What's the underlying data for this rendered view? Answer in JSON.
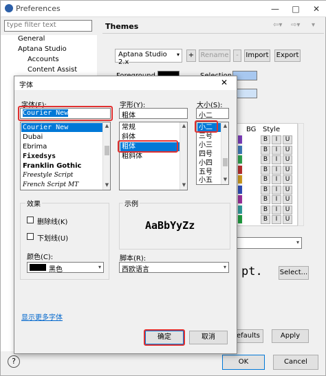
{
  "prefs": {
    "title": "Preferences",
    "filter_placeholder": "type filter text",
    "tree": [
      "General",
      "Aptana Studio",
      "Accounts",
      "Content Assist"
    ],
    "section_title": "Themes",
    "theme_select": "Aptana Studio 2.x",
    "buttons": {
      "add": "+",
      "rename": "Rename",
      "remove": "-",
      "import": "Import",
      "export": "Export"
    },
    "foreground_label": "Foreground",
    "selection_label": "Selection",
    "grid_headers": {
      "bg": "BG",
      "style": "Style"
    },
    "style_buttons": [
      "B",
      "I",
      "U"
    ],
    "font_preview_tail": "pt.",
    "select_button": "Select...",
    "restore_defaults": "Restore Defaults",
    "apply": "Apply",
    "ok": "OK",
    "cancel": "Cancel",
    "help_icon": "question-mark-icon"
  },
  "font_dialog": {
    "title": "字体",
    "font_label": "字体(F):",
    "font_value": "Courier New",
    "font_list": [
      "Courier New",
      "Dubai",
      "Ebrima",
      "Fixedsys",
      "Franklin Gothic",
      "Freestyle Script",
      "French Script MT"
    ],
    "style_label": "字形(Y):",
    "style_value": "粗体",
    "style_list": [
      "常规",
      "斜体",
      "粗体",
      "粗斜体"
    ],
    "size_label": "大小(S):",
    "size_value": "小二",
    "size_list": [
      "小二",
      "三号",
      "小三",
      "四号",
      "小四",
      "五号",
      "小五"
    ],
    "effects_label": "效果",
    "strikeout": "删除线(K)",
    "underline": "下划线(U)",
    "color_label": "颜色(C):",
    "color_value": "黑色",
    "sample_label": "示例",
    "sample_text": "AaBbYyZz",
    "script_label": "脚本(R):",
    "script_value": "西欧语言",
    "more_fonts": "显示更多字体",
    "ok": "确定",
    "cancel": "取消",
    "accent": "#0078d7",
    "highlight_color": "#e03030"
  }
}
